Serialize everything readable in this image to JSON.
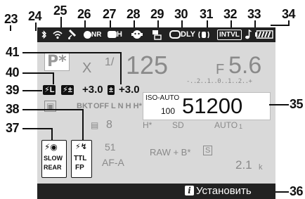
{
  "callouts": {
    "top": [
      "23",
      "24",
      "25",
      "26",
      "27",
      "28",
      "29",
      "30",
      "31",
      "32",
      "33",
      "34"
    ],
    "left": [
      "41",
      "40",
      "39",
      "38",
      "37"
    ],
    "right": [
      "35",
      "36"
    ]
  },
  "topbar": {
    "bluetooth_icon": "bluetooth",
    "wifi_icon": "wifi",
    "gps_icon": "satellite",
    "timer_label": "NR",
    "hdr_label": "H",
    "face_icon": "face-detect",
    "wireless_flash_icon": "flash",
    "dly_label": "DLY",
    "vr_icon": "vibration-reduction",
    "intvl_label": "INTVL",
    "beep_icon": "note",
    "battery_icon": "battery"
  },
  "exposure": {
    "mode": "P*",
    "mode_x": "X",
    "shutter_fraction": "1/",
    "shutter": "125",
    "aperture_prefix": "F",
    "aperture": "5.6",
    "meter_scale": "-..2..1..0..1..2..+",
    "flash_comp_value": "+3.0",
    "exp_comp_value": "+3.0",
    "flash_lock_label": "L"
  },
  "iso": {
    "auto_label": "ISO-AUTO",
    "base_value": "100",
    "value": "51200"
  },
  "row2": {
    "bkt_label": "BKT",
    "bkt_items": "OFF L N H H*"
  },
  "row3": {
    "release_value": "8",
    "hdr_plus": "H*",
    "card": "SD",
    "wb": "AUTO",
    "wb_sub": "1"
  },
  "row4": {
    "af_points": "51",
    "af_mode": "AF-A",
    "quality": "RAW + B*",
    "quality_box": "S",
    "remaining": "2.1",
    "remaining_unit": "k"
  },
  "flash_mode": {
    "slow": "SLOW",
    "rear": "REAR"
  },
  "flash_control": {
    "ttl": "TTL",
    "fp": "FP"
  },
  "bottom": {
    "info_letter": "i",
    "install_label": "Установить"
  }
}
